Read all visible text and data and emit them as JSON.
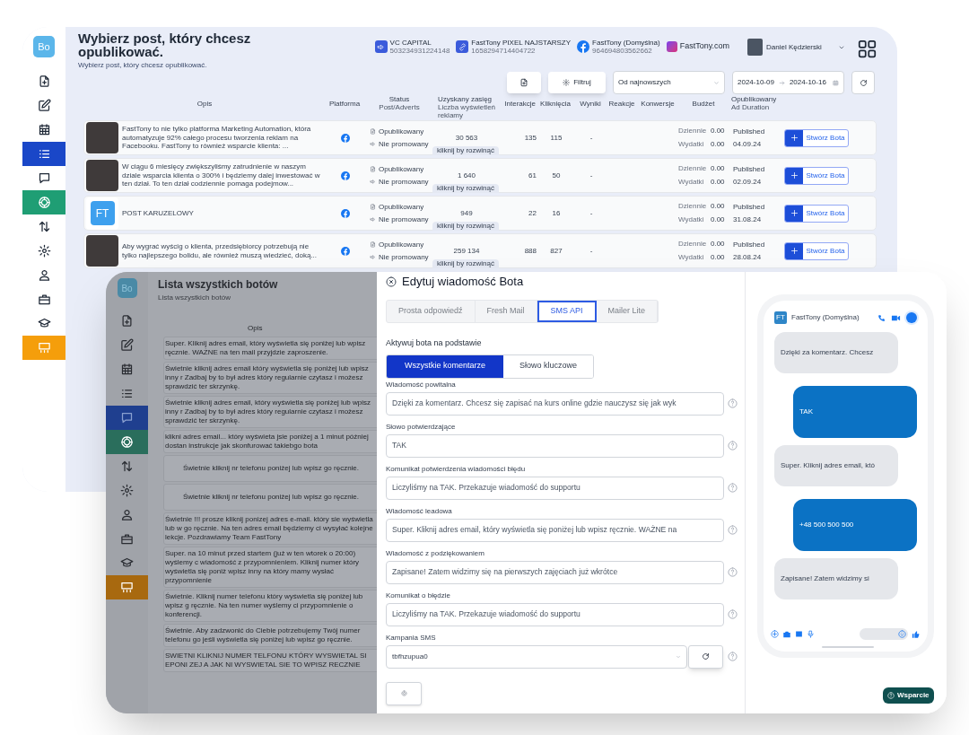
{
  "posts_window": {
    "logo": "Bo",
    "sidebar": [
      {
        "kind": "file-plus",
        "selected": false
      },
      {
        "kind": "pencil",
        "selected": false
      },
      {
        "kind": "calendar",
        "selected": false
      },
      {
        "kind": "list",
        "selected": true
      },
      {
        "kind": "chat",
        "selected": false
      },
      {
        "kind": "swirl",
        "selected": false,
        "color": "#1f9e74"
      },
      {
        "kind": "arrows",
        "selected": false
      },
      {
        "kind": "gear",
        "selected": false
      },
      {
        "kind": "user",
        "selected": false
      },
      {
        "kind": "briefcase",
        "selected": false
      },
      {
        "kind": "cap",
        "selected": false
      },
      {
        "kind": "board",
        "selected": false,
        "color": "#f59e0b"
      }
    ],
    "title": "Wybierz post, który chcesz opublikować.",
    "subtitle": "Wybierz post, który chcesz opublikować.",
    "accounts": [
      {
        "kind": "megaphone",
        "name": "VC CAPITAL",
        "id": "503234931224148"
      },
      {
        "kind": "link",
        "name": "FastTony PIXEL NAJSTARSZY",
        "id": "1658294714404722"
      },
      {
        "kind": "facebook",
        "name": "FastTony (Domyślna)",
        "id": "964694803562662"
      },
      {
        "kind": "instagram",
        "name": "FastTony.com"
      }
    ],
    "user": {
      "name": "Daniel Kędzierski"
    },
    "toolbar": {
      "filter": "Filtruj",
      "sort": "Od najnowszych",
      "date_from": "2024-10-09",
      "date_to": "2024-10-16"
    },
    "columns": [
      {
        "label": "Opis"
      },
      {
        "label": "Platforma"
      },
      {
        "label": "Status",
        "sub": "Post/Adverts"
      },
      {
        "label": "Uzyskany zasięg",
        "sub": "Liczba wyświetleń reklamy"
      },
      {
        "label": "Interakcje"
      },
      {
        "label": "Kliknięcia"
      },
      {
        "label": "Wyniki"
      },
      {
        "label": "Reakcje"
      },
      {
        "label": "Konwersje"
      },
      {
        "label": "Budżet"
      },
      {
        "label": "Opublikowany",
        "sub": "Ad Duration"
      }
    ],
    "rows": [
      {
        "kind": "photo",
        "description": "FastTony to nie tylko platforma Marketing Automation, która automatyzuje 92% całego procesu tworzenia reklam na Facebooku. FastTony to również wsparcie klienta: ...",
        "status": "Opublikowany",
        "promotion": "Nie promowany",
        "reach": "30 563",
        "expand": "kliknij by rozwinąć",
        "interactions": "135",
        "clicks": "115",
        "results": "-",
        "daily_label": "Dziennie",
        "daily": "0.00",
        "spend_label": "Wydatki",
        "spend": "0.00",
        "published": "Published",
        "date": "04.09.24",
        "button": "Stwórz Bota"
      },
      {
        "kind": "photo",
        "description": "W ciągu 6 miesięcy zwiększyliśmy zatrudnienie w naszym dziale wsparcia klienta o 300% i będziemy dalej inwestować w ten dział. To ten dział codziennie pomaga podejmow...",
        "status": "Opublikowany",
        "promotion": "Nie promowany",
        "reach": "1 640",
        "expand": "kliknij by rozwinąć",
        "interactions": "61",
        "clicks": "50",
        "results": "-",
        "daily_label": "Dziennie",
        "daily": "0.00",
        "spend_label": "Wydatki",
        "spend": "0.00",
        "published": "Published",
        "date": "02.09.24",
        "button": "Stwórz Bota"
      },
      {
        "kind": "logo",
        "logo_text": "FT",
        "description": "POST KARUZELOWY",
        "status": "Opublikowany",
        "promotion": "Nie promowany",
        "reach": "949",
        "expand": "kliknij by rozwinąć",
        "interactions": "22",
        "clicks": "16",
        "results": "-",
        "daily_label": "Dziennie",
        "daily": "0.00",
        "spend_label": "Wydatki",
        "spend": "0.00",
        "published": "Published",
        "date": "31.08.24",
        "button": "Stwórz Bota"
      },
      {
        "kind": "photo",
        "description": "Aby wygrać wyścig o klienta, przedsiębiorcy potrzebują nie tylko najlepszego bolidu, ale również muszą wiedzieć, doką...",
        "status": "Opublikowany",
        "promotion": "Nie promowany",
        "reach": "259 134",
        "expand": "kliknij by rozwinąć",
        "interactions": "888",
        "clicks": "827",
        "results": "-",
        "daily_label": "Dziennie",
        "daily": "0.00",
        "spend_label": "Wydatki",
        "spend": "0.00",
        "published": "Published",
        "date": "28.08.24",
        "button": "Stwórz Bota"
      }
    ]
  },
  "bots_window": {
    "logo": "Bo",
    "sidebar": [
      {
        "kind": "file-plus",
        "selected": false
      },
      {
        "kind": "pencil",
        "selected": false
      },
      {
        "kind": "calendar",
        "selected": false
      },
      {
        "kind": "list",
        "selected": false
      },
      {
        "kind": "chat",
        "selected": true
      },
      {
        "kind": "swirl",
        "selected": false,
        "color": "#2a6e5c"
      },
      {
        "kind": "arrows",
        "selected": false
      },
      {
        "kind": "gear",
        "selected": false
      },
      {
        "kind": "user",
        "selected": false
      },
      {
        "kind": "briefcase",
        "selected": false
      },
      {
        "kind": "cap",
        "selected": false
      },
      {
        "kind": "board",
        "selected": false,
        "color": "#a8690f"
      }
    ],
    "title": "Lista wszystkich botów",
    "subtitle": "Lista wszystkich botów",
    "column": "Opis",
    "rows": [
      {
        "kind": "left",
        "text": "Super. Kliknij adres email, który wyświetla się poniżej lub wpisz ręcznie.\nWAŻNE na ten mail przyjdzie zaproszenie."
      },
      {
        "kind": "left",
        "text": "Świetnie kliknij adres email który wyświetla się poniżej lub wpisz inny r\nZadbaj by to był adres który regularnie czytasz i możesz sprawdzić ter\nskrzynkę."
      },
      {
        "kind": "left",
        "text": "Świetnie kliknij adres email, który wyświetla się poniżej lub wpisz inny r\nZadbaj by to był adres który regularnie czytasz i możesz sprawdzić ter\nskrzynkę."
      },
      {
        "kind": "left",
        "text": "klikni adres email... który wyświeta jsie poniżej a 1 minut później dostan\ninstrukcje jak skonfurować takiebgo bota"
      },
      {
        "kind": "center",
        "text": "Świetnie kliknij nr telefonu poniżej lub wpisz go ręcznie."
      },
      {
        "kind": "center",
        "text": "Świetnie kliknij nr telefonu poniżej lub wpisz go ręcznie."
      },
      {
        "kind": "left",
        "text": "Świetnie !!! prosze kliknij ponizej adres e-mail. który sie wyświetla lub w\ngo ręcznie. Na ten adres email będziemy ci wysyłać kolejne lekcje.\nPozdrawiamy Team FastTony"
      },
      {
        "kind": "left",
        "text": "Super. na 10 minut przed startem (już w ten wtorek o 20:00) wyślemy c\nwiadomość z przypomnieniem. Kliknij numer który wyświetla się poniż\nwpisz inny na który mamy wysłać przypomnienie"
      },
      {
        "kind": "left",
        "text": "Świetnie. Kliknij numer telefonu który wyświetla się poniżej lub wpisz g\nręcznie. Na ten numer wyślemy ci przypomnienie o konferencji."
      },
      {
        "kind": "left",
        "text": "Świetnie. Aby zadzwonić do Ciebie potrzebujemy Twój numer telefonu\ngo jeśli wyświetla się poniżej lub wpisz go ręcznie."
      },
      {
        "kind": "left",
        "text": "SWIETNI KLIKNIJ NUMER TELFONU KTÓRY WYSWIETAL SI EPONI ZEJ A JAK NI\nWYSWIETAL SIE TO WPISZ RECZNIE"
      }
    ]
  },
  "edit_dialog": {
    "title": "Edytuj wiadomość Bota",
    "tabs": [
      {
        "label": "Prosta odpowiedź",
        "selected": false
      },
      {
        "label": "Fresh Mail",
        "selected": false
      },
      {
        "label": "SMS API",
        "selected": true
      },
      {
        "label": "Mailer Lite",
        "selected": false
      }
    ],
    "trigger_label": "Aktywuj bota na podstawie",
    "trigger_options": [
      {
        "label": "Wszystkie komentarze",
        "selected": true
      },
      {
        "label": "Słowo kluczowe",
        "selected": false
      }
    ],
    "fields": [
      {
        "label": "Wiadomość powitalna",
        "value": "Dzięki za komentarz. Chcesz się zapisać na kurs online gdzie nauczysz się jak wyk"
      },
      {
        "label": "Słowo potwierdzające",
        "value": "TAK"
      },
      {
        "label": "Komunikat potwierdzenia wiadomości błędu",
        "value": "Liczyliśmy na TAK. Przekazuje wiadomość do supportu"
      },
      {
        "label": "Wiadomość leadowa",
        "value": "Super. Kliknij adres email, który wyświetla się poniżej lub wpisz ręcznie. WAŻNE na"
      },
      {
        "label": "Wiadomość z podziękowaniem",
        "value": "Zapisane! Zatem widzimy się na pierwszych zajęciach już wkrótce"
      },
      {
        "label": "Komunikat o błędzie",
        "value": "Liczyliśmy na TAK. Przekazuje wiadomość do supportu"
      }
    ],
    "campaign": {
      "label": "Kampania SMS",
      "value": "tbfhzupua0"
    }
  },
  "phone_preview": {
    "logo": "FT",
    "name": "FastTony (Domyślna)",
    "messages": [
      {
        "kind": "bot",
        "text": "Dzięki za komentarz. Chcesz"
      },
      {
        "kind": "user",
        "text": "TAK"
      },
      {
        "kind": "bot",
        "text": "Super. Kliknij adres email, któ"
      },
      {
        "kind": "user",
        "text": "+48 500 500 500"
      },
      {
        "kind": "bot",
        "text": "Zapisane! Zatem widzimy si"
      }
    ]
  },
  "support_button": "Wsparcie"
}
